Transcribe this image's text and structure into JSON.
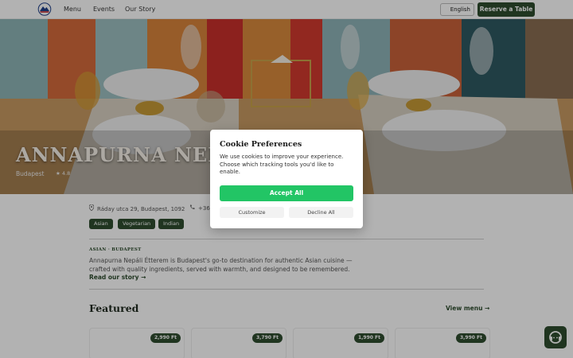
{
  "nav": {
    "links": [
      "Menu",
      "Events",
      "Our Story"
    ],
    "language": "English",
    "reserve_label": "Reserve a Table"
  },
  "hero": {
    "title": "ANNAPURNA NEPÁLI",
    "city": "Budapest",
    "rating": "★ 4.8"
  },
  "info": {
    "address": "Ráday utca 29, Budapest, 1092",
    "phone": "+367",
    "tags": [
      "Asian",
      "Vegetarian",
      "Indian"
    ]
  },
  "about": {
    "kicker": "ASIAN · BUDAPEST",
    "text": "Annapurna Nepáli Étterem is Budapest's go-to destination for authentic Asian cuisine — crafted with quality ingredients, served with warmth, and designed to be remembered. ",
    "link": "Read our story →"
  },
  "featured": {
    "title": "Featured",
    "view_menu": "View menu →",
    "prices": [
      "2,990 Ft",
      "3,790 Ft",
      "1,990 Ft",
      "3,990 Ft"
    ]
  },
  "cookie": {
    "title": "Cookie Preferences",
    "body": "We use cookies to improve your experience. Choose which tracking tools you'd like to enable.",
    "accept": "Accept All",
    "customize": "Customize",
    "decline": "Decline All"
  },
  "colors": {
    "brand_green": "#2e4d2f",
    "accept_green": "#22c565"
  }
}
